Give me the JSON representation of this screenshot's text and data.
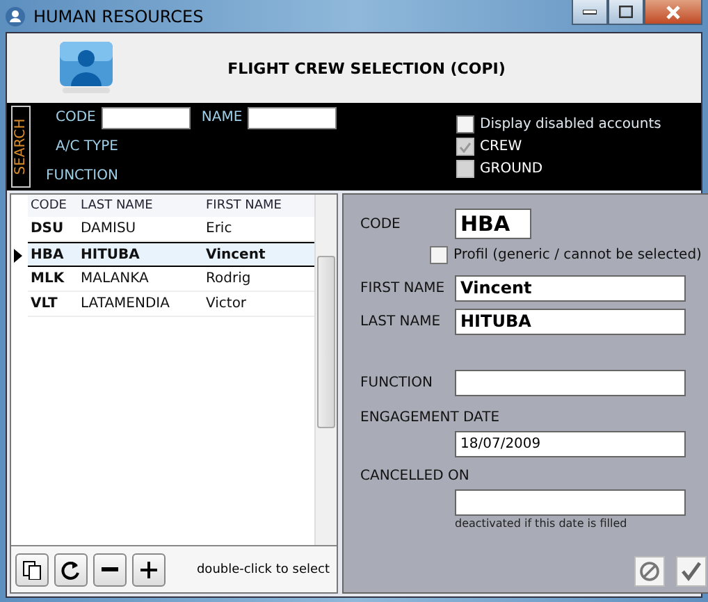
{
  "window": {
    "title": "HUMAN RESOURCES"
  },
  "header": {
    "title": "FLIGHT CREW SELECTION (COPI)"
  },
  "search": {
    "label": "SEARCH",
    "fields": [
      {
        "label": "CODE"
      },
      {
        "label": "NAME"
      }
    ],
    "labels": [
      "A/C TYPE",
      "FUNCTION"
    ],
    "checkboxes": [
      {
        "label": "Display disabled accounts",
        "checked": false,
        "disabled": false
      },
      {
        "label": "CREW",
        "checked": true,
        "disabled": true
      },
      {
        "label": "GROUND",
        "checked": false,
        "disabled": true
      }
    ]
  },
  "table": {
    "columns": [
      "CODE",
      "LAST NAME",
      "FIRST NAME"
    ],
    "rows": [
      {
        "code": "DSU",
        "last": "DAMISU",
        "first": "Eric",
        "selected": false
      },
      {
        "code": "HBA",
        "last": "HITUBA",
        "first": "Vincent",
        "selected": true
      },
      {
        "code": "MLK",
        "last": "MALANKA",
        "first": "Rodrig",
        "selected": false
      },
      {
        "code": "VLT",
        "last": "LATAMENDIA",
        "first": "Victor",
        "selected": false
      }
    ]
  },
  "hint": "double-click to select",
  "detail": {
    "code_label": "CODE",
    "code": "HBA",
    "profil": {
      "label": "Profil  (generic / cannot be selected)",
      "checked": false
    },
    "first_label": "FIRST NAME",
    "first": "Vincent",
    "last_label": "LAST NAME",
    "last": "HITUBA",
    "function_label": "FUNCTION",
    "engagement_label": "ENGAGEMENT DATE",
    "engagement": "18/07/2009",
    "cancelled_label": "CANCELLED ON",
    "note": "deactivated if this date is filled"
  }
}
